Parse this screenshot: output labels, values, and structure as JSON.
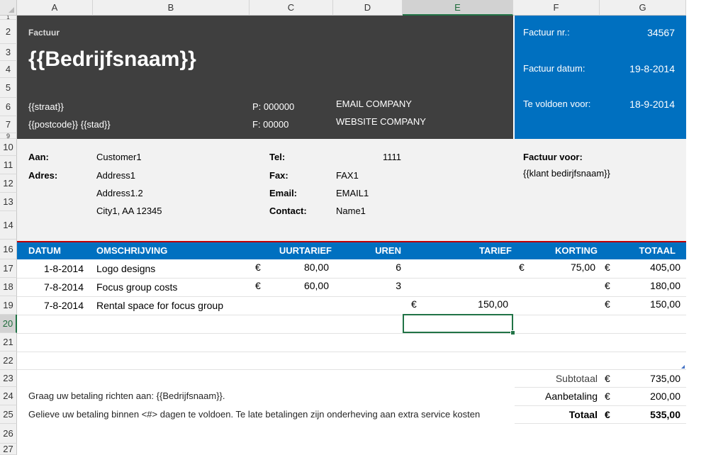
{
  "columns": [
    "A",
    "B",
    "C",
    "D",
    "E",
    "F",
    "G"
  ],
  "rows": [
    "1",
    "2",
    "3",
    "4",
    "5",
    "6",
    "7",
    "9",
    "10",
    "11",
    "12",
    "13",
    "14",
    "16",
    "17",
    "18",
    "19",
    "20",
    "21",
    "22",
    "23",
    "24",
    "25",
    "26",
    "27"
  ],
  "header": {
    "label": "Factuur",
    "company": "{{Bedrijfsnaam}}",
    "street": "{{straat}}",
    "postcode_city": "{{postcode}} {{stad}}",
    "phone": "P: 000000",
    "fax": "F: 00000",
    "email": "EMAIL COMPANY",
    "website": "WEBSITE COMPANY"
  },
  "invoice_info": {
    "number_label": "Factuur nr.:",
    "number": "34567",
    "date_label": "Factuur datum:",
    "date": "19-8-2014",
    "due_label": "Te voldoen voor:",
    "due": "18-9-2014"
  },
  "customer": {
    "to_label": "Aan:",
    "to": "Customer1",
    "address_label": "Adres:",
    "address1": "Address1",
    "address2": "Address1.2",
    "city": "City1, AA 12345",
    "tel_label": "Tel:",
    "tel": "1111",
    "fax_label": "Fax:",
    "fax": "FAX1",
    "email_label": "Email:",
    "email": "EMAIL1",
    "contact_label": "Contact:",
    "contact": "Name1",
    "invoice_for_label": "Factuur voor:",
    "invoice_for": "{{klant bedirjfsnaam}}"
  },
  "table": {
    "headers": {
      "datum": "DATUM",
      "omschrijving": "OMSCHRIJVING",
      "uurtarief": "UURTARIEF",
      "uren": "UREN",
      "tarief": "TARIEF",
      "korting": "KORTING",
      "totaal": "TOTAAL"
    },
    "currency": "€",
    "rows": [
      {
        "datum": "1-8-2014",
        "omschrijving": "Logo designs",
        "uurtarief": "80,00",
        "uren": "6",
        "tarief": "",
        "korting": "75,00",
        "totaal": "405,00"
      },
      {
        "datum": "7-8-2014",
        "omschrijving": "Focus group costs",
        "uurtarief": "60,00",
        "uren": "3",
        "tarief": "",
        "korting": "",
        "totaal": "180,00"
      },
      {
        "datum": "7-8-2014",
        "omschrijving": "Rental space for focus group",
        "uurtarief": "",
        "uren": "",
        "tarief": "150,00",
        "korting": "",
        "totaal": "150,00"
      }
    ]
  },
  "summary": {
    "subtotal_label": "Subtotaal",
    "subtotal": "735,00",
    "payment_label": "Aanbetaling",
    "payment": "200,00",
    "total_label": "Totaal",
    "total": "535,00"
  },
  "footer": {
    "line1": "Graag uw betaling richten aan: {{Bedrijfsnaam}}.",
    "line2": "Gelieve uw betaling binnen <#> dagen te voldoen. Te late betalingen zijn onderheving aan extra service kosten"
  },
  "colors": {
    "dark_header": "#3f3f3f",
    "blue": "#0070c0",
    "light_gray": "#f2f2f2",
    "selection": "#217346"
  }
}
